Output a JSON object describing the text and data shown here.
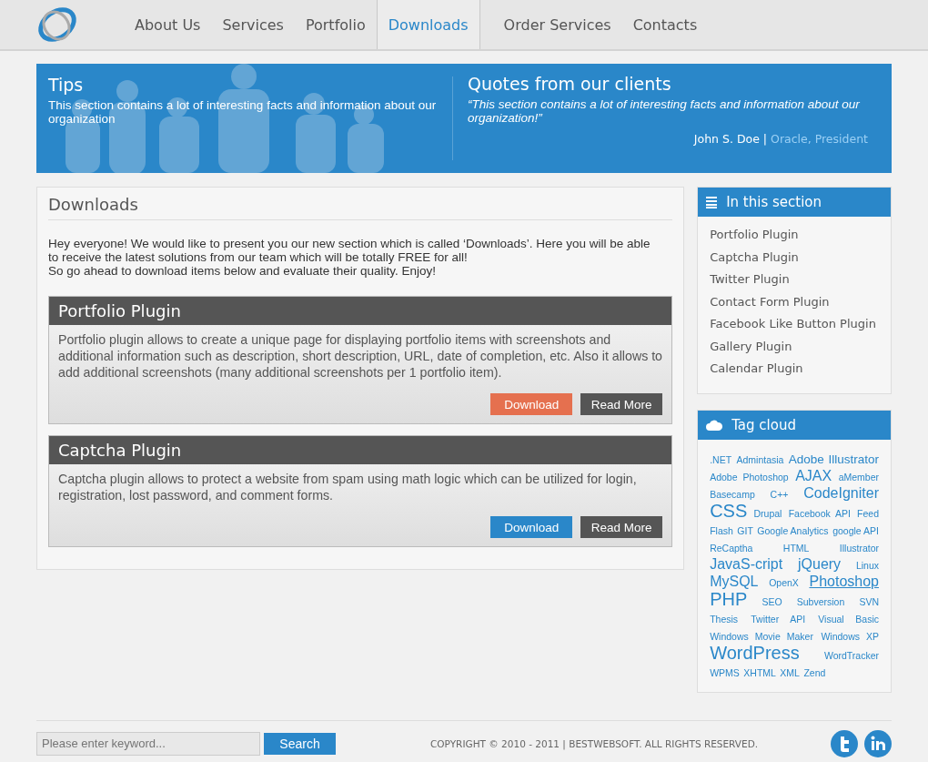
{
  "nav": [
    {
      "label": "About Us",
      "selected": false
    },
    {
      "label": "Services",
      "selected": false
    },
    {
      "label": "Portfolio",
      "selected": false
    },
    {
      "label": "Downloads",
      "selected": true
    },
    {
      "label": "Order Services",
      "selected": false
    },
    {
      "label": "Contacts",
      "selected": false
    }
  ],
  "banner": {
    "tips": {
      "title": "Tips",
      "text": "This section contains a lot of interesting facts and information about our organization"
    },
    "quotes": {
      "title": "Quotes from our clients",
      "quote": "“This section contains a lot of interesting facts and information about our organization!”",
      "author": "John S. Doe",
      "separator": "|",
      "company": "Oracle, President"
    }
  },
  "main": {
    "title": "Downloads",
    "intro": [
      "Hey everyone! We would like to present you our new section which is called ‘Downloads’. Here you will be able to receive the latest solutions from our team which will be totally FREE for all!",
      "So go ahead to download items below and evaluate their quality. Enjoy!"
    ],
    "items": [
      {
        "title": "Portfolio Plugin",
        "text": "Portfolio plugin allows to create a unique page for displaying portfolio items with screenshots and additional information such as description, short description, URL, date of completion, etc. Also it allows to add additional screenshots (many additional screenshots per 1 portfolio item).",
        "download": "Download",
        "download_hovered": true,
        "more": "Read More"
      },
      {
        "title": "Captcha Plugin",
        "text": "Captcha plugin allows to protect a website from spam using math logic which can be utilized for login, registration, lost password, and comment forms.",
        "download": "Download",
        "download_hovered": false,
        "more": "Read More"
      }
    ]
  },
  "section": {
    "title": "In this section",
    "items": [
      "Portfolio Plugin",
      "Captcha Plugin",
      "Twitter Plugin",
      "Contact Form Plugin",
      "Facebook Like Button Plugin",
      "Gallery Plugin",
      "Calendar Plugin"
    ]
  },
  "tag_cloud": {
    "title": "Tag cloud",
    "tags": [
      {
        "label": ".NET",
        "kind": "small",
        "hovered": false
      },
      {
        "label": "Admintasia",
        "kind": "small",
        "hovered": false
      },
      {
        "label": "Adobe Illustrator",
        "kind": "medium",
        "hovered": false
      },
      {
        "label": "Adobe Photoshop",
        "kind": "small",
        "hovered": false
      },
      {
        "label": "AJAX",
        "kind": "large",
        "hovered": false
      },
      {
        "label": "aMember",
        "kind": "small",
        "hovered": false
      },
      {
        "label": "Basecamp",
        "kind": "small",
        "hovered": false
      },
      {
        "label": "C++",
        "kind": "small",
        "hovered": false
      },
      {
        "label": "CodeIgniter",
        "kind": "large",
        "hovered": false
      },
      {
        "label": "CSS",
        "kind": "xlarge",
        "hovered": false
      },
      {
        "label": "Drupal",
        "kind": "small",
        "hovered": false
      },
      {
        "label": "Facebook API",
        "kind": "small",
        "hovered": false
      },
      {
        "label": "Feed",
        "kind": "small",
        "hovered": false
      },
      {
        "label": "Flash",
        "kind": "small",
        "hovered": false
      },
      {
        "label": "GIT",
        "kind": "small",
        "hovered": false
      },
      {
        "label": "Google Analytics",
        "kind": "small",
        "hovered": false
      },
      {
        "label": "google API",
        "kind": "small",
        "hovered": false
      },
      {
        "label": "ReCaptha",
        "kind": "small",
        "hovered": false
      },
      {
        "label": "HTML",
        "kind": "small",
        "hovered": false
      },
      {
        "label": "Illustrator",
        "kind": "small",
        "hovered": false
      },
      {
        "label": "JavaS-cript",
        "kind": "large",
        "hovered": false
      },
      {
        "label": "jQuery",
        "kind": "large",
        "hovered": false
      },
      {
        "label": "Linux",
        "kind": "small",
        "hovered": false
      },
      {
        "label": "MySQL",
        "kind": "large",
        "hovered": false
      },
      {
        "label": "OpenX",
        "kind": "small",
        "hovered": false
      },
      {
        "label": "Photoshop",
        "kind": "large",
        "hovered": true
      },
      {
        "label": "PHP",
        "kind": "xlarge",
        "hovered": false
      },
      {
        "label": "SEO",
        "kind": "small",
        "hovered": false
      },
      {
        "label": "Subversion",
        "kind": "small",
        "hovered": false
      },
      {
        "label": "SVN",
        "kind": "small",
        "hovered": false
      },
      {
        "label": "Thesis",
        "kind": "small",
        "hovered": false
      },
      {
        "label": "Twitter API",
        "kind": "small",
        "hovered": false
      },
      {
        "label": "Visual Basic",
        "kind": "small",
        "hovered": false
      },
      {
        "label": "Windows Movie Maker",
        "kind": "small",
        "hovered": false
      },
      {
        "label": "Windows XP",
        "kind": "small",
        "hovered": false
      },
      {
        "label": "WordPress",
        "kind": "xlarge",
        "hovered": false
      },
      {
        "label": "WordTracker",
        "kind": "small",
        "hovered": false
      },
      {
        "label": "WPMS",
        "kind": "small",
        "hovered": false
      },
      {
        "label": "XHTML",
        "kind": "small",
        "hovered": false
      },
      {
        "label": "XML",
        "kind": "small",
        "hovered": false
      },
      {
        "label": "Zend",
        "kind": "small",
        "hovered": false
      }
    ]
  },
  "footer": {
    "search": {
      "placeholder": "Please enter keyword...",
      "button": "Search"
    },
    "copyright": "COPYRIGHT © 2010 - 2011 | BESTWEBSOFT. ALL RIGHTS RESERVED."
  }
}
